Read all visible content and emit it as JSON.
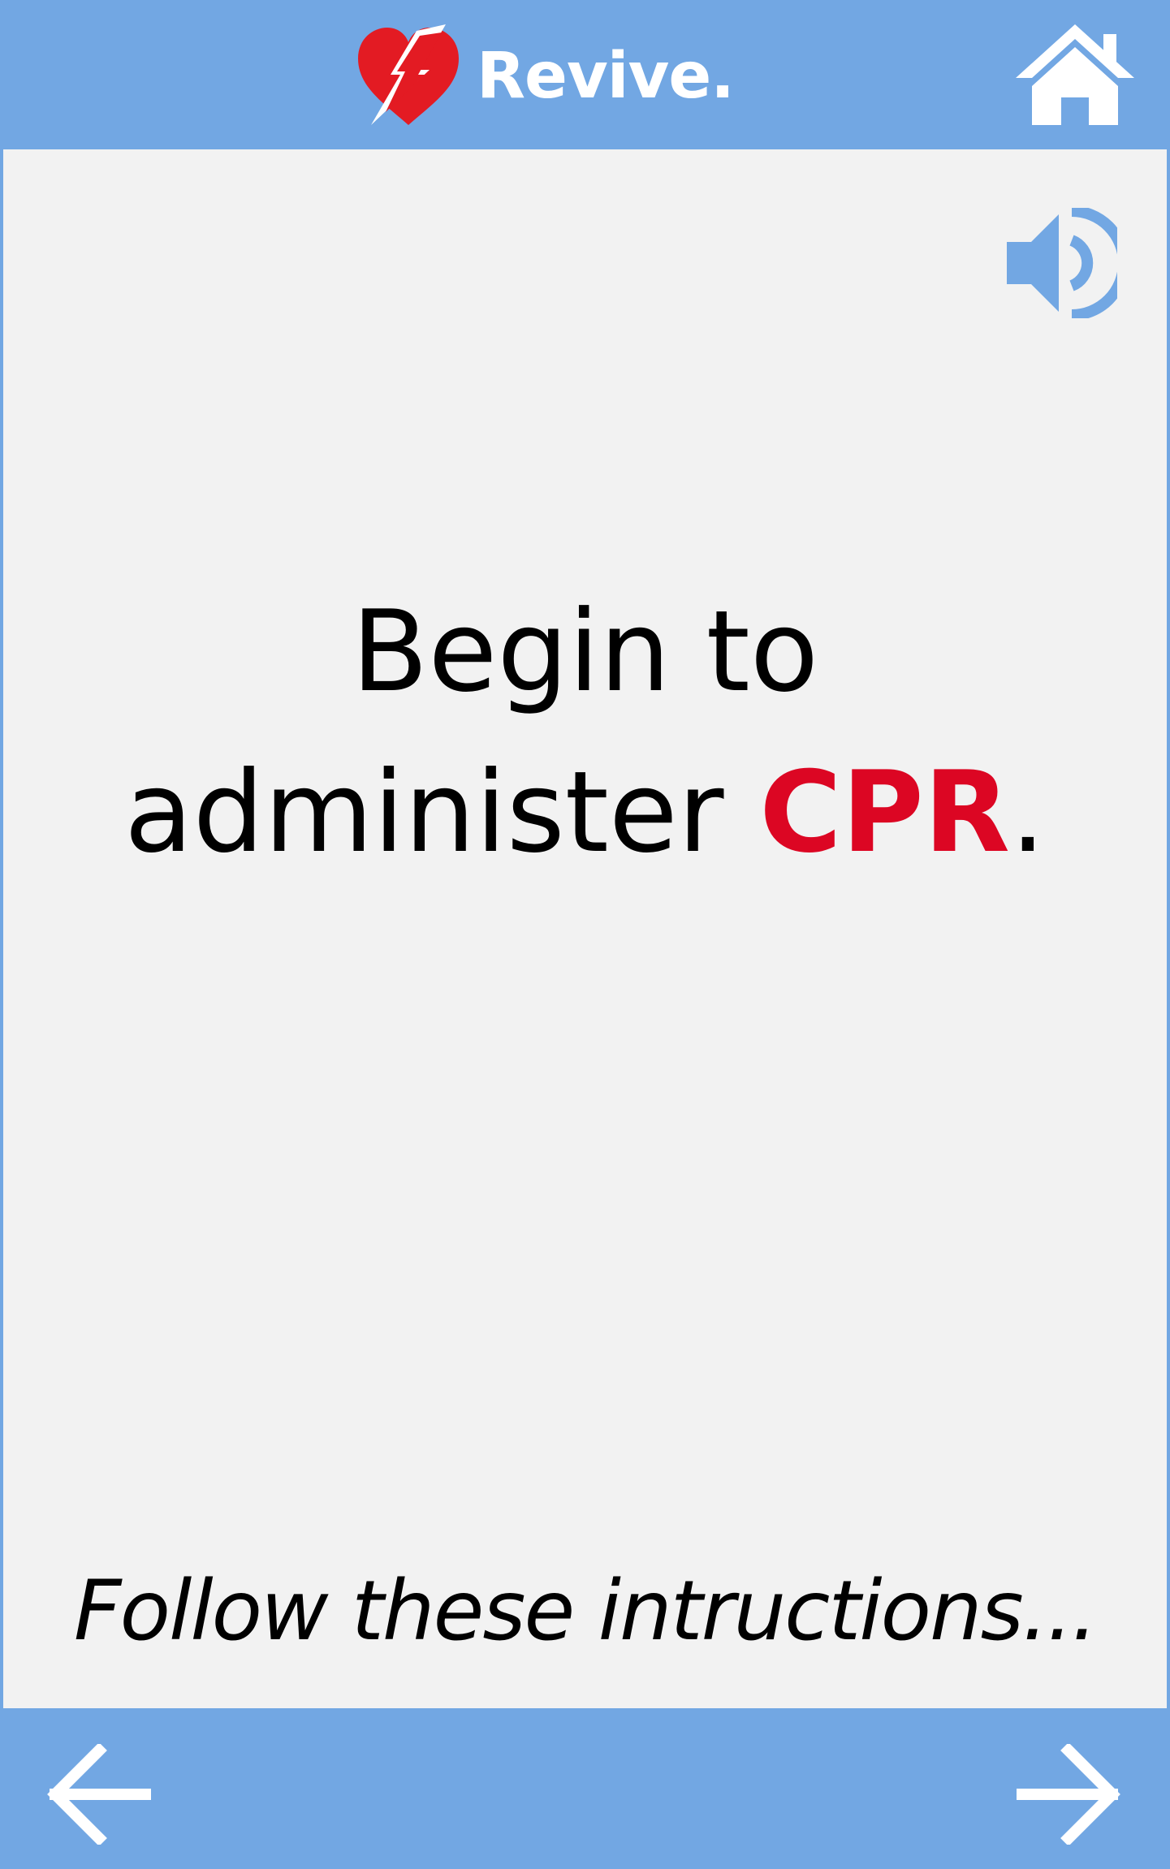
{
  "app": {
    "name": "Revive.",
    "colors": {
      "bar": "#72a7e3",
      "panel": "#f2f2f2",
      "accent": "#dc0623",
      "text": "#000000",
      "icon_light": "#ffffff",
      "logo_red": "#e31b23"
    }
  },
  "header": {
    "logo_icon": "heart-lightning-icon",
    "home_icon": "home-icon"
  },
  "main": {
    "speaker_icon": "speaker-icon",
    "message": {
      "line1": "Begin to",
      "line2_prefix": "administer ",
      "line2_accent": "CPR",
      "line2_suffix": "."
    },
    "footer_note": "Follow these intructions..."
  },
  "bottom_bar": {
    "back_icon": "arrow-left-icon",
    "next_icon": "arrow-right-icon"
  }
}
